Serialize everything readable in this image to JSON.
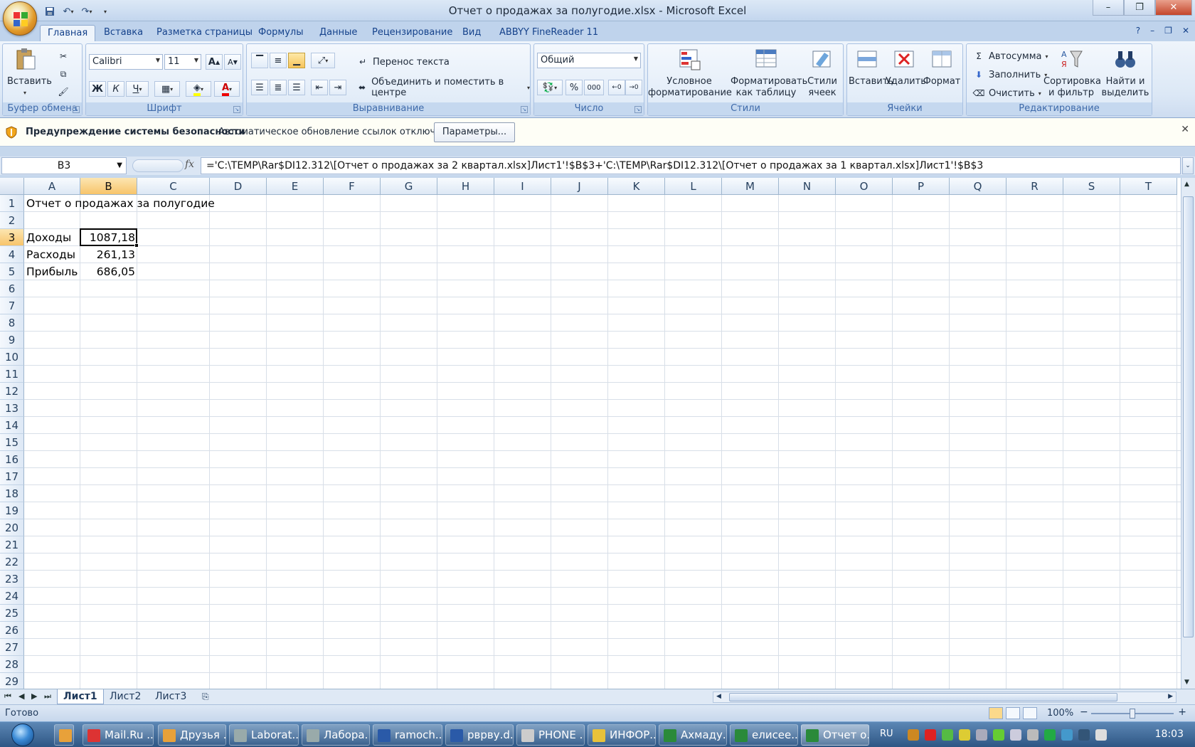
{
  "window": {
    "title": "Отчет о продажах за полугодие.xlsx - Microsoft Excel"
  },
  "ribbon_tabs": [
    {
      "label": "Главная"
    },
    {
      "label": "Вставка"
    },
    {
      "label": "Разметка страницы"
    },
    {
      "label": "Формулы"
    },
    {
      "label": "Данные"
    },
    {
      "label": "Рецензирование"
    },
    {
      "label": "Вид"
    },
    {
      "label": "ABBYY FineReader 11"
    }
  ],
  "ribbon": {
    "clipboard": {
      "label": "Буфер обмена",
      "paste": "Вставить"
    },
    "font": {
      "label": "Шрифт",
      "name": "Calibri",
      "size": "11",
      "grow": "A",
      "shrink": "A",
      "bold": "Ж",
      "italic": "К",
      "underline": "Ч",
      "font_color_letter": "A"
    },
    "alignment": {
      "label": "Выравнивание",
      "wrap": "Перенос текста",
      "merge": "Объединить и поместить в центре"
    },
    "number": {
      "label": "Число",
      "format": "Общий",
      "percent": "%",
      "thousands": "000"
    },
    "styles": {
      "label": "Стили",
      "conditional": "Условное форматирование",
      "as_table": "Форматировать как таблицу",
      "cell_styles": "Стили ячеек"
    },
    "cells": {
      "label": "Ячейки",
      "insert": "Вставить",
      "delete": "Удалить",
      "format": "Формат"
    },
    "editing": {
      "label": "Редактирование",
      "autosum": "Автосумма",
      "fill": "Заполнить",
      "clear": "Очистить",
      "sort": "Сортировка и фильтр",
      "find": "Найти и выделить"
    }
  },
  "security": {
    "title": "Предупреждение системы безопасности",
    "message": "Автоматическое обновление ссылок отключено",
    "button": "Параметры..."
  },
  "formula_bar": {
    "name_box": "B3",
    "fx": "fx",
    "formula": "='C:\\TEMP\\Rar$DI12.312\\[Отчет о продажах за 2 квартал.xlsx]Лист1'!$B$3+'C:\\TEMP\\Rar$DI12.312\\[Отчет о продажах за 1 квартал.xlsx]Лист1'!$B$3"
  },
  "sheet": {
    "columns": [
      "A",
      "B",
      "C",
      "D",
      "E",
      "F",
      "G",
      "H",
      "I",
      "J",
      "K",
      "L",
      "M",
      "N",
      "O",
      "P",
      "Q",
      "R",
      "S",
      "T"
    ],
    "rows": [
      "1",
      "2",
      "3",
      "4",
      "5",
      "6",
      "7",
      "8",
      "9",
      "10",
      "11",
      "12",
      "13",
      "14",
      "15",
      "16",
      "17",
      "18",
      "19",
      "20",
      "21",
      "22",
      "23",
      "24",
      "25",
      "26",
      "27",
      "28",
      "29"
    ],
    "cells": {
      "A1": "Отчет о продажах за полугодие",
      "A3": "Доходы",
      "B3": "1087,18",
      "A4": "Расходы",
      "B4": "261,13",
      "A5": "Прибыль",
      "B5": "686,05"
    }
  },
  "sheet_tabs": [
    "Лист1",
    "Лист2",
    "Лист3"
  ],
  "status": {
    "ready": "Готово",
    "zoom": "100%",
    "zoom_minus": "−",
    "zoom_plus": "+"
  },
  "taskbar": {
    "items": [
      "Mail.Ru ...",
      "Друзья ...",
      "Laborat...",
      "Лабора...",
      "ramoch...",
      "рврву.d...",
      "PHONE ...",
      "ИНФОР...",
      "Ахмаду...",
      "елисее...",
      "Отчет о..."
    ],
    "lang": "RU",
    "clock": "18:03"
  },
  "colors": {
    "accent": "#15428b",
    "selection_header": "#f7c46a",
    "taskbar": "#2e5684"
  }
}
